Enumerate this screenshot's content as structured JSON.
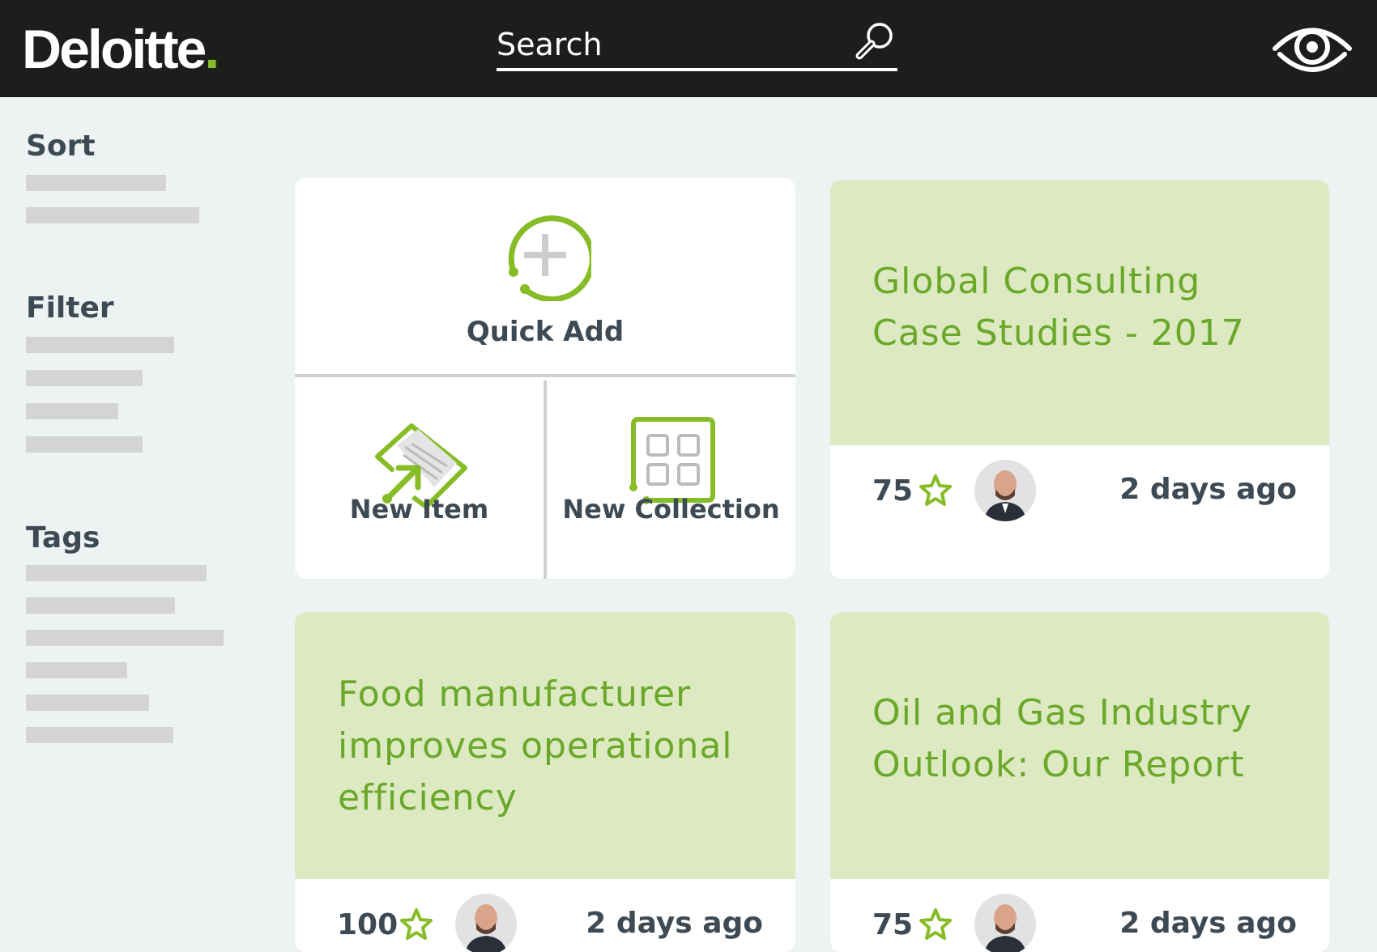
{
  "header": {
    "logo_text": "Deloitte",
    "logo_dot": ".",
    "search_placeholder": "Search"
  },
  "sidebar": {
    "sort_label": "Sort",
    "filter_label": "Filter",
    "tags_label": "Tags"
  },
  "quick_add": {
    "label": "Quick Add",
    "new_item_label": "New Item",
    "new_collection_label": "New Collection"
  },
  "cards": [
    {
      "title_line1": "Global Consulting",
      "title_line2": "Case Studies - 2017",
      "rating": "75",
      "time": "2 days ago"
    },
    {
      "title_line1": "Food manufacturer",
      "title_line2": "improves operational",
      "title_line3": "efficiency",
      "rating": "100",
      "time": "2 days ago"
    },
    {
      "title_line1": "Oil and Gas Industry",
      "title_line2": "Outlook: Our Report",
      "rating": "75",
      "time": "2 days ago"
    }
  ],
  "colors": {
    "brand_green": "#86bc25",
    "title_green": "#6aa82a",
    "card_header_bg": "#dde9c1",
    "topbar_bg": "#1f1c1c",
    "page_bg": "#edf3f3"
  }
}
